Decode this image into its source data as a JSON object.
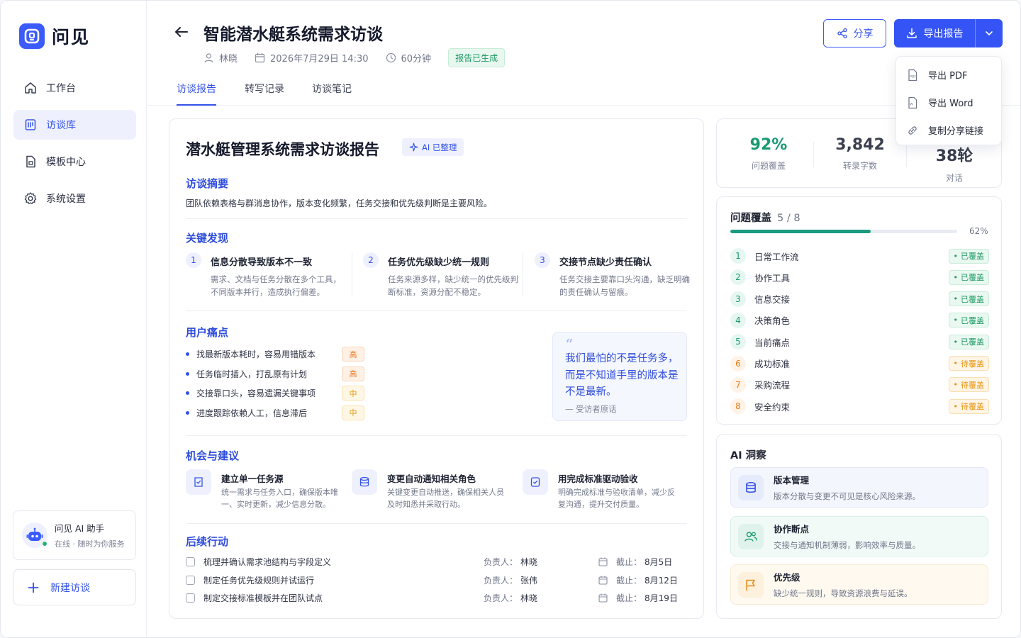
{
  "app": {
    "name": "问见"
  },
  "sidebar": {
    "items": [
      {
        "label": "工作台",
        "icon": "home-icon",
        "active": false
      },
      {
        "label": "访谈库",
        "icon": "library-icon",
        "active": true
      },
      {
        "label": "模板中心",
        "icon": "template-icon",
        "active": false
      },
      {
        "label": "系统设置",
        "icon": "gear-icon",
        "active": false
      }
    ],
    "assistant": {
      "name": "问见 AI 助手",
      "status": "在线 · 随时为你服务"
    },
    "new_interview": "新建访谈"
  },
  "header": {
    "title": "智能潜水艇系统需求访谈",
    "interviewer": "林晓",
    "datetime": "2026年7月29日 14:30",
    "duration": "60分钟",
    "status_badge": "报告已生成",
    "share_label": "分享",
    "export_label": "导出报告"
  },
  "export_menu": {
    "items": [
      {
        "label": "导出 PDF",
        "icon": "pdf-file-icon"
      },
      {
        "label": "导出 Word",
        "icon": "word-file-icon"
      },
      {
        "label": "复制分享链接",
        "icon": "link-icon"
      }
    ]
  },
  "tabs": [
    {
      "label": "访谈报告",
      "active": true
    },
    {
      "label": "转写记录",
      "active": false
    },
    {
      "label": "访谈笔记",
      "active": false
    }
  ],
  "report": {
    "title": "潜水艇管理系统需求访谈报告",
    "ai_tag": "AI 已整理",
    "summary_title": "访谈摘要",
    "summary": "团队依赖表格与群消息协作，版本变化频繁，任务交接和优先级判断是主要风险。",
    "findings_title": "关键发现",
    "findings": [
      {
        "num": "1",
        "title": "信息分散导致版本不一致",
        "desc": "需求、文档与任务分散在多个工具，不同版本并行，造成执行偏差。"
      },
      {
        "num": "2",
        "title": "任务优先级缺少统一规则",
        "desc": "任务来源多样，缺少统一的优先级判断标准，资源分配不稳定。"
      },
      {
        "num": "3",
        "title": "交接节点缺少责任确认",
        "desc": "任务交接主要靠口头沟通，缺乏明确的责任确认与留痕。"
      }
    ],
    "pain_title": "用户痛点",
    "pains": [
      {
        "text": "找最新版本耗时，容易用错版本",
        "level": "高",
        "severity": "high"
      },
      {
        "text": "任务临时插入，打乱原有计划",
        "level": "高",
        "severity": "high"
      },
      {
        "text": "交接靠口头，容易遗漏关键事项",
        "level": "中",
        "severity": "mid"
      },
      {
        "text": "进度跟踪依赖人工，信息滞后",
        "level": "中",
        "severity": "mid"
      }
    ],
    "quote": {
      "text": "我们最怕的不是任务多，而是不知道手里的版本是不是最新。",
      "source": "— 受访者原话"
    },
    "opp_title": "机会与建议",
    "opportunities": [
      {
        "title": "建立单一任务源",
        "desc": "统一需求与任务入口，确保版本唯一、实时更新，减少信息分散。",
        "icon": "task-source-icon"
      },
      {
        "title": "变更自动通知相关角色",
        "desc": "关键变更自动推送，确保相关人员及时知悉并采取行动。",
        "icon": "database-icon"
      },
      {
        "title": "用完成标准驱动验收",
        "desc": "明确完成标准与验收清单，减少反复沟通，提升交付质量。",
        "icon": "checklist-icon"
      }
    ],
    "actions_title": "后续行动",
    "owner_label": "负责人：",
    "due_label": "截止：",
    "actions": [
      {
        "text": "梳理并确认需求池结构与字段定义",
        "owner": "林晓",
        "due": "8月5日"
      },
      {
        "text": "制定任务优先级规则并试运行",
        "owner": "张伟",
        "due": "8月12日"
      },
      {
        "text": "制定交接标准模板并在团队试点",
        "owner": "林晓",
        "due": "8月19日"
      }
    ]
  },
  "stats": [
    {
      "value": "92%",
      "label": "问题覆盖"
    },
    {
      "value": "3,842",
      "label": "转录字数"
    },
    {
      "value": "38轮",
      "label": "对话"
    }
  ],
  "coverage": {
    "title": "问题覆盖",
    "count": "5 / 8",
    "progress": 0.62,
    "percent": "62%",
    "items": [
      {
        "num": "1",
        "label": "日常工作流",
        "status": "已覆盖",
        "state": "ok"
      },
      {
        "num": "2",
        "label": "协作工具",
        "status": "已覆盖",
        "state": "ok"
      },
      {
        "num": "3",
        "label": "信息交接",
        "status": "已覆盖",
        "state": "ok"
      },
      {
        "num": "4",
        "label": "决策角色",
        "status": "已覆盖",
        "state": "ok"
      },
      {
        "num": "5",
        "label": "当前痛点",
        "status": "已覆盖",
        "state": "ok"
      },
      {
        "num": "6",
        "label": "成功标准",
        "status": "待覆盖",
        "state": "todo"
      },
      {
        "num": "7",
        "label": "采购流程",
        "status": "待覆盖",
        "state": "todo"
      },
      {
        "num": "8",
        "label": "安全约束",
        "status": "待覆盖",
        "state": "todo"
      }
    ]
  },
  "insights": {
    "title": "AI 洞察",
    "items": [
      {
        "title": "版本管理",
        "desc": "版本分散与变更不可见是核心风险来源。",
        "icon": "database-icon"
      },
      {
        "title": "协作断点",
        "desc": "交接与通知机制薄弱，影响效率与质量。",
        "icon": "users-icon"
      },
      {
        "title": "优先级",
        "desc": "缺少统一规则，导致资源浪费与延误。",
        "icon": "flag-icon"
      }
    ]
  },
  "colors": {
    "accent": "#3554f5",
    "success": "#1a9a73",
    "warning": "#ea7b16"
  }
}
